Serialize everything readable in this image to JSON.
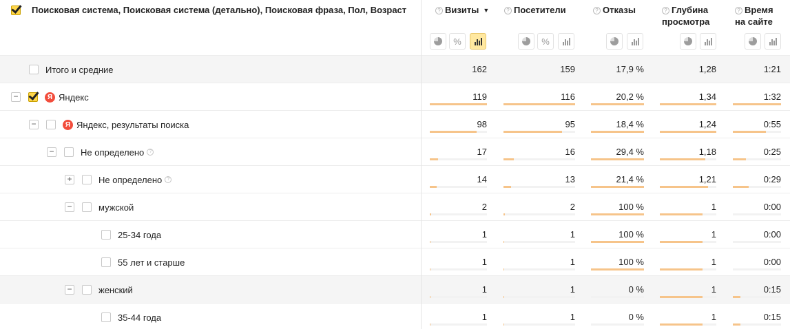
{
  "dimensions_header": "Поисковая система, Поисковая система (детально), Поисковая фраза, Пол, Возраст",
  "columns": [
    {
      "label": "Визиты",
      "sorted": "▼",
      "hint": "?"
    },
    {
      "label": "Посетители",
      "hint": "?"
    },
    {
      "label": "Отказы",
      "hint": "?"
    },
    {
      "label": "Глубина\nпросмотра",
      "hint": "?"
    },
    {
      "label": "Время\nна сайте",
      "hint": "?"
    }
  ],
  "view_buttons": {
    "pie": "pie-chart",
    "percent": "%",
    "bar": "bar-chart"
  },
  "yandex_letter": "Я",
  "rows": [
    {
      "label": "Итого и средние",
      "toggle": "",
      "icon": "",
      "values": [
        "162",
        "159",
        "17,9 %",
        "1,28",
        "1:21"
      ],
      "fill": []
    },
    {
      "label": "Яндекс",
      "toggle": "−",
      "icon": "yandex",
      "values": [
        "119",
        "116",
        "20,2 %",
        "1,34",
        "1:32"
      ],
      "fill": [
        1.0,
        1.0,
        1.0,
        1.0,
        1.0
      ]
    },
    {
      "label": "Яндекс, результаты поиска",
      "toggle": "−",
      "icon": "yandex",
      "values": [
        "98",
        "95",
        "18,4 %",
        "1,24",
        "0:55"
      ],
      "fill": [
        0.82,
        0.82,
        1.0,
        1.0,
        0.68
      ]
    },
    {
      "label": "Не определено",
      "toggle": "−",
      "icon": "",
      "values": [
        "17",
        "16",
        "29,4 %",
        "1,18",
        "0:25"
      ],
      "fill": [
        0.14,
        0.14,
        1.0,
        0.8,
        0.27
      ]
    },
    {
      "label": "Не определено",
      "toggle": "+",
      "icon": "",
      "values": [
        "14",
        "13",
        "21,4 %",
        "1,21",
        "0:29"
      ],
      "fill": [
        0.12,
        0.11,
        1.0,
        0.85,
        0.33
      ]
    },
    {
      "label": "мужской",
      "toggle": "−",
      "icon": "",
      "values": [
        "2",
        "2",
        "100 %",
        "1",
        "0:00"
      ],
      "fill": [
        0.02,
        0.02,
        1.0,
        0.75,
        0.0
      ]
    },
    {
      "label": "25-34 года",
      "toggle": "",
      "icon": "",
      "values": [
        "1",
        "1",
        "100 %",
        "1",
        "0:00"
      ],
      "fill": [
        0.01,
        0.01,
        1.0,
        0.75,
        0.0
      ]
    },
    {
      "label": "55 лет и старше",
      "toggle": "",
      "icon": "",
      "values": [
        "1",
        "1",
        "100 %",
        "1",
        "0:00"
      ],
      "fill": [
        0.01,
        0.01,
        1.0,
        0.75,
        0.0
      ]
    },
    {
      "label": "женский",
      "toggle": "−",
      "icon": "",
      "values": [
        "1",
        "1",
        "0 %",
        "1",
        "0:15"
      ],
      "fill": [
        0.01,
        0.01,
        0.0,
        0.75,
        0.16
      ]
    },
    {
      "label": "35-44 года",
      "toggle": "",
      "icon": "",
      "values": [
        "1",
        "1",
        "0 %",
        "1",
        "0:15"
      ],
      "fill": [
        0.01,
        0.01,
        0.0,
        0.75,
        0.16
      ]
    }
  ]
}
